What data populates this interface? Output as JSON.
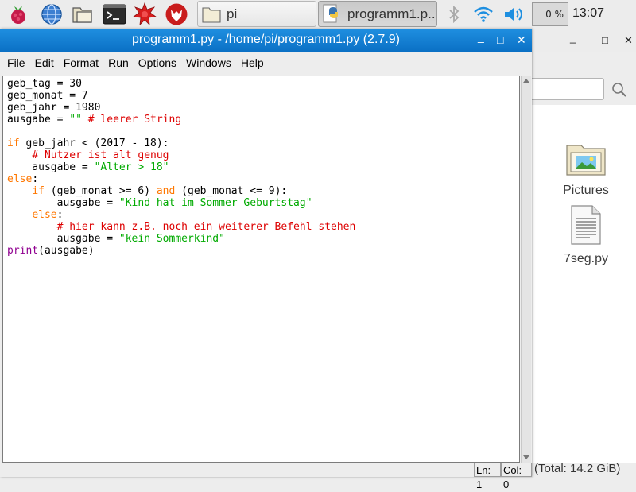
{
  "taskbar": {
    "launchers": [
      "raspberry-menu-icon",
      "web-browser-icon",
      "file-manager-icon",
      "terminal-icon",
      "mathematica-icon",
      "wolfram-icon"
    ],
    "tasks": [
      {
        "label": "pi",
        "icon": "folder-icon"
      },
      {
        "label": "programm1.p...",
        "icon": "python-icon"
      }
    ],
    "tray": {
      "bluetooth": "bluetooth-icon",
      "wifi": "wifi-icon",
      "volume": "volume-icon"
    },
    "cpu_usage": "0 %",
    "clock": "13:07"
  },
  "editor_window": {
    "title": "programm1.py - /home/pi/programm1.py (2.7.9)",
    "menu": [
      {
        "first": "F",
        "rest": "ile"
      },
      {
        "first": "E",
        "rest": "dit"
      },
      {
        "first": "F",
        "rest": "ormat"
      },
      {
        "first": "R",
        "rest": "un"
      },
      {
        "first": "O",
        "rest": "ptions"
      },
      {
        "first": "W",
        "rest": "indows"
      },
      {
        "first": "H",
        "rest": "elp"
      }
    ],
    "code_lines": [
      [
        [
          "t",
          "geb_tag = 30"
        ]
      ],
      [
        [
          "t",
          "geb_monat = 7"
        ]
      ],
      [
        [
          "t",
          "geb_jahr = 1980"
        ]
      ],
      [
        [
          "t",
          "ausgabe = "
        ],
        [
          "str",
          "\"\""
        ],
        [
          "t",
          " "
        ],
        [
          "cm",
          "# leerer String"
        ]
      ],
      [
        [
          "t",
          ""
        ]
      ],
      [
        [
          "kw",
          "if"
        ],
        [
          "t",
          " geb_jahr < (2017 - 18):"
        ]
      ],
      [
        [
          "t",
          "    "
        ],
        [
          "cm",
          "# Nutzer ist alt genug"
        ]
      ],
      [
        [
          "t",
          "    ausgabe = "
        ],
        [
          "str",
          "\"Alter > 18\""
        ]
      ],
      [
        [
          "kw",
          "else"
        ],
        [
          "t",
          ":"
        ]
      ],
      [
        [
          "t",
          "    "
        ],
        [
          "kw",
          "if"
        ],
        [
          "t",
          " (geb_monat >= 6) "
        ],
        [
          "kw",
          "and"
        ],
        [
          "t",
          " (geb_monat <= 9):"
        ]
      ],
      [
        [
          "t",
          "        ausgabe = "
        ],
        [
          "str",
          "\"Kind hat im Sommer Geburtstag\""
        ]
      ],
      [
        [
          "t",
          "    "
        ],
        [
          "kw",
          "else"
        ],
        [
          "t",
          ":"
        ]
      ],
      [
        [
          "t",
          "        "
        ],
        [
          "cm",
          "# hier kann z.B. noch ein weiterer Befehl stehen"
        ]
      ],
      [
        [
          "t",
          "        ausgabe = "
        ],
        [
          "str",
          "\"kein Sommerkind\""
        ]
      ],
      [
        [
          "bi",
          "print"
        ],
        [
          "t",
          "(ausgabe)"
        ]
      ]
    ],
    "status": {
      "line": "Ln: 1",
      "col": "Col: 0"
    }
  },
  "file_manager": {
    "items": [
      {
        "label": "Pictures",
        "icon": "pictures-folder-icon"
      },
      {
        "label": "7seg.py",
        "icon": "text-file-icon"
      }
    ],
    "status": "(Total: 14.2 GiB)"
  }
}
